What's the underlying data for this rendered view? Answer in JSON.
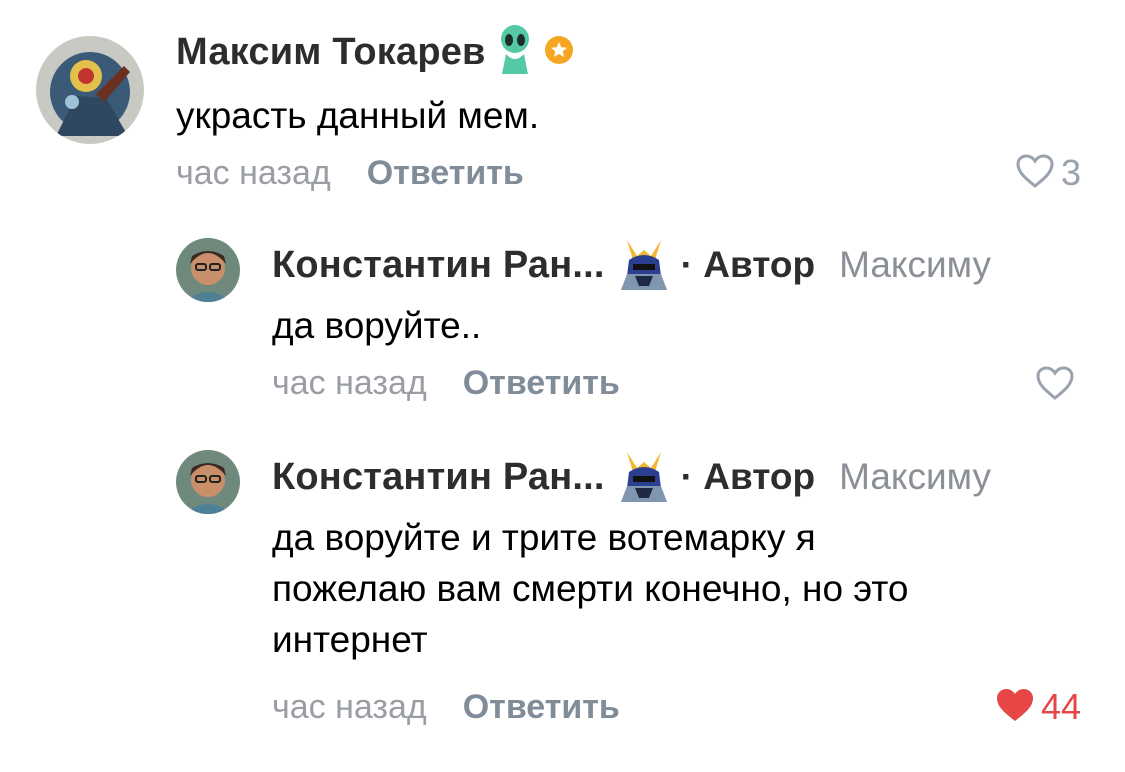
{
  "comments": [
    {
      "author": "Максим Токарев",
      "text": "украсть данный мем.",
      "time": "час назад",
      "reply_label": "Ответить",
      "likes": "3",
      "liked": false,
      "badges": [
        "alien-icon",
        "star-badge-icon"
      ]
    },
    {
      "author": "Константин Ран...",
      "author_tag": "· Автор",
      "reply_to": "Максиму",
      "text": "да воруйте..",
      "time": "час назад",
      "reply_label": "Ответить",
      "likes": "",
      "liked": false,
      "badges": [
        "samurai-icon"
      ]
    },
    {
      "author": "Константин Ран...",
      "author_tag": "· Автор",
      "reply_to": "Максиму",
      "text_lines": [
        "да воруйте и трите вотемарку я",
        "пожелаю вам смерти конечно, но это",
        "интернет"
      ],
      "time": "час назад",
      "reply_label": "Ответить",
      "likes": "44",
      "liked": true,
      "badges": [
        "samurai-icon"
      ]
    }
  ],
  "colors": {
    "name": "#2c2d2e",
    "secondary": "#9a9ea4",
    "reply_button": "#818c99",
    "liked_red": "#e64646",
    "badge_orange": "#f5a623"
  }
}
